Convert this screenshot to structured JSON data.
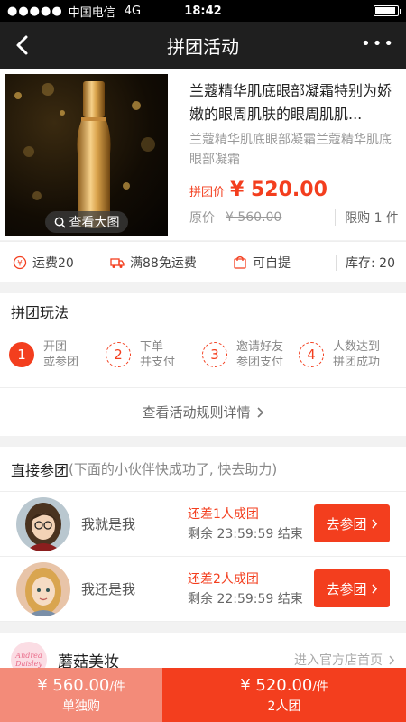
{
  "status_bar": {
    "signal": "●●●●●",
    "carrier": "中国电信",
    "network": "4G",
    "time": "18:42"
  },
  "nav": {
    "title": "拼团活动",
    "back_icon": "chevron-left-icon",
    "more": "•••"
  },
  "product": {
    "name": "兰蔻精华肌底眼部凝霜特别为娇嫩的眼周肌肤的眼周肌肌...",
    "subtitle": "兰蔻精华肌底眼部凝霜兰蔻精华肌底眼部凝霜",
    "group_price_label": "拼团价",
    "group_price": "¥ 520.00",
    "original_label": "原价",
    "original_price": "¥ 560.00",
    "limit": "限购 1 件",
    "view_image": "查看大图"
  },
  "features": {
    "shipping": "运费20",
    "free_shipping": "满88免运费",
    "pickup": "可自提",
    "stock": "库存: 20"
  },
  "play": {
    "title": "拼团玩法",
    "steps": [
      {
        "num": "1",
        "line1": "开团",
        "line2": "或参团"
      },
      {
        "num": "2",
        "line1": "下单",
        "line2": "并支付"
      },
      {
        "num": "3",
        "line1": "邀请好友",
        "line2": "参团支付"
      },
      {
        "num": "4",
        "line1": "人数达到",
        "line2": "拼团成功"
      }
    ],
    "rules_link": "查看活动规则详情"
  },
  "join": {
    "title": "直接参团",
    "hint": "(下面的小伙伴快成功了, 快去助力)",
    "members": [
      {
        "name": "我就是我",
        "need": "还差1人成团",
        "remain": "剩余 23:59:59 结束",
        "button": "去参团"
      },
      {
        "name": "我还是我",
        "need": "还差2人成团",
        "remain": "剩余 22:59:59 结束",
        "button": "去参团"
      }
    ]
  },
  "shop": {
    "logo_text": "Andrea Daisley",
    "name": "蘑菇美妆",
    "link": "进入官方店首页"
  },
  "bottom": {
    "solo_price": "¥ 560.00",
    "solo_unit": "/件",
    "solo_label": "单独购",
    "group_price": "¥ 520.00",
    "group_unit": "/件",
    "group_label": "2人团"
  },
  "colors": {
    "accent": "#f33e1e",
    "solo_bg": "#f38b79",
    "nav_bg": "#1f1f1f"
  }
}
